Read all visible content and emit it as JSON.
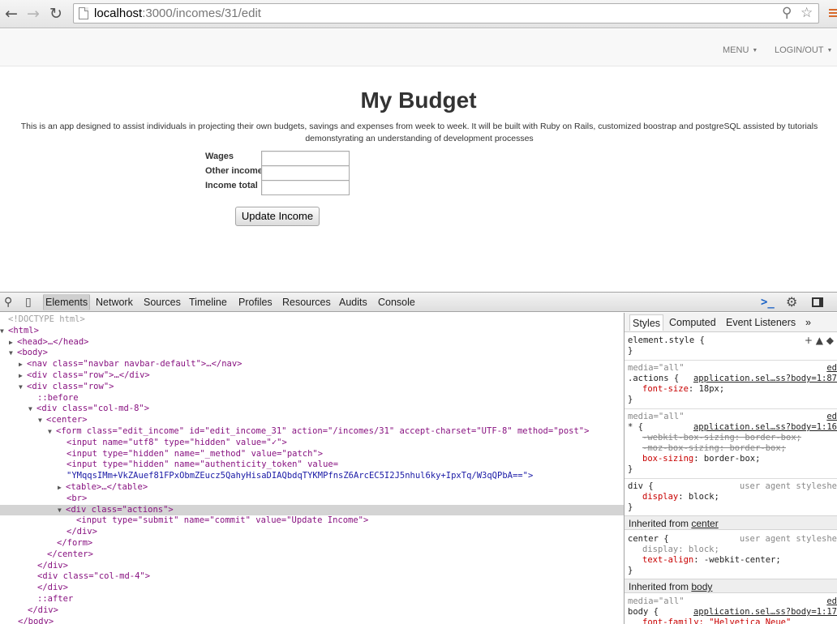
{
  "browser": {
    "url_host": "localhost",
    "url_path": ":3000/incomes/31/edit",
    "back_icon": "arrow-left",
    "forward_icon": "arrow-right",
    "reload_icon": "reload",
    "zoom_icon": "magnifier",
    "bookmark_icon": "star",
    "menu_icon": "hamburger"
  },
  "navbar": {
    "menu_label": "MENU",
    "login_label": "LOGIN/OUT"
  },
  "page": {
    "title": "My Budget",
    "intro": "This is an app designed to assist individuals in projecting their own budgets, savings and expenses from week to week. It will be built with Ruby on Rails, customized boostrap and postgreSQL assisted by tutorials demonstyrating an understanding of development processes",
    "fields": [
      {
        "label": "Wages",
        "value": ""
      },
      {
        "label": "Other income",
        "value": ""
      },
      {
        "label": "Income total",
        "value": ""
      }
    ],
    "submit_label": "Update Income"
  },
  "devtools": {
    "tabs": [
      "Elements",
      "Network",
      "Sources",
      "Timeline",
      "Profiles",
      "Resources",
      "Audits",
      "Console"
    ],
    "active_tab": "Elements",
    "dom_lines": [
      {
        "text": "<!DOCTYPE html>"
      },
      {
        "text": "<html>"
      },
      {
        "text": "<head>…</head>"
      },
      {
        "text": "<body>"
      },
      {
        "text": "<nav class=\"navbar navbar-default\">…</nav>"
      },
      {
        "text": "<div class=\"row\">…</div>"
      },
      {
        "text": "<div class=\"row\">"
      },
      {
        "text": "::before"
      },
      {
        "text": "<div class=\"col-md-8\">"
      },
      {
        "text": "<center>"
      },
      {
        "text": "<form class=\"edit_income\" id=\"edit_income_31\" action=\"/incomes/31\" accept-charset=\"UTF-8\" method=\"post\">"
      },
      {
        "text": "<input name=\"utf8\" type=\"hidden\" value=\"✓\">"
      },
      {
        "text": "<input type=\"hidden\" name=\"_method\" value=\"patch\">"
      },
      {
        "text": "<input type=\"hidden\" name=\"authenticity_token\" value="
      },
      {
        "text": "\"YMqqsIMm+VkZAuef81FPxObmZEucz5QahyHisaDIAQbdqTYKMPfnsZ6ArcEC5I2J5nhul6ky+IpxTq/W3qQPbA==\">"
      },
      {
        "text": "<table>…</table>"
      },
      {
        "text": "<br>"
      },
      {
        "text": "<div class=\"actions\">"
      },
      {
        "text": "<input type=\"submit\" name=\"commit\" value=\"Update Income\">"
      },
      {
        "text": "</div>"
      },
      {
        "text": "</form>"
      },
      {
        "text": "</center>"
      },
      {
        "text": "</div>"
      },
      {
        "text": "<div class=\"col-md-4\">"
      },
      {
        "text": "</div>"
      },
      {
        "text": "::after"
      },
      {
        "text": "</div>"
      },
      {
        "text": "</body>"
      }
    ],
    "styles": {
      "tabs": [
        "Styles",
        "Computed",
        "Event Listeners"
      ],
      "more_tabs": "»",
      "element_style": "element.style {",
      "close_brace": "}",
      "media_all": "media=\"all\"",
      "edit_link": "ed",
      "actions_selector": ".actions {",
      "actions_source": "application.sel…ss?body=1:87",
      "actions_prop": "font-size",
      "actions_value": "18px;",
      "star_selector": "* {",
      "star_source": "application.sel…ss?body=1:16",
      "webkit_box": "-webkit-box-sizing: border-box;",
      "moz_box": "-moz-box-sizing: border-box;",
      "box_sizing_prop": "box-sizing",
      "box_sizing_value": "border-box;",
      "div_selector": "div {",
      "ua_stylesheet": "user agent styleshe",
      "display_prop": "display",
      "display_value": "block;",
      "inherited_center_prefix": "Inherited from ",
      "inherited_center_link": "center",
      "center_selector": "center {",
      "center_display": "display: block;",
      "text_align_prop": "text-align",
      "text_align_value": "-webkit-center;",
      "inherited_body_link": "body",
      "body_selector": "body {",
      "body_source": "application.sel…ss?body=1:17",
      "font_family_line": "font-family: \"Helvetica Neue\""
    }
  }
}
